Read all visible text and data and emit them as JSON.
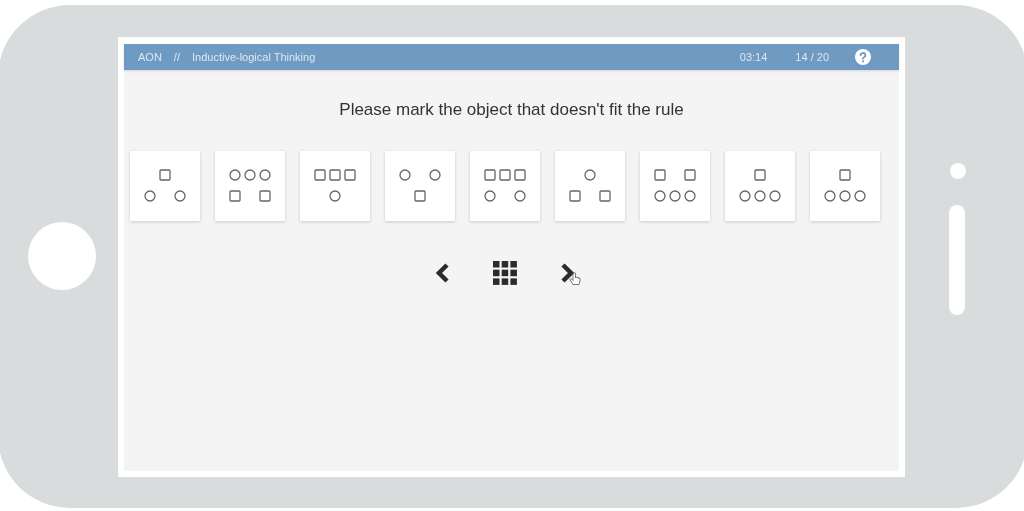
{
  "header": {
    "brand": "AON",
    "separator": "//",
    "section": "Inductive-logical Thinking",
    "timer": "03:14",
    "progress": "14 / 20"
  },
  "question": "Please mark the object that doesn't fit the rule",
  "options": [
    {
      "rows": [
        [
          {
            "kind": "square"
          }
        ],
        [
          {
            "kind": "circle"
          },
          {
            "kind": "gap"
          },
          {
            "kind": "circle"
          }
        ]
      ]
    },
    {
      "rows": [
        [
          {
            "kind": "circle"
          },
          {
            "kind": "circle"
          },
          {
            "kind": "circle"
          }
        ],
        [
          {
            "kind": "square"
          },
          {
            "kind": "gap"
          },
          {
            "kind": "square"
          }
        ]
      ]
    },
    {
      "rows": [
        [
          {
            "kind": "square"
          },
          {
            "kind": "square"
          },
          {
            "kind": "square"
          }
        ],
        [
          {
            "kind": "circle"
          }
        ]
      ]
    },
    {
      "rows": [
        [
          {
            "kind": "circle"
          },
          {
            "kind": "gap"
          },
          {
            "kind": "circle"
          }
        ],
        [
          {
            "kind": "square"
          }
        ]
      ]
    },
    {
      "rows": [
        [
          {
            "kind": "square"
          },
          {
            "kind": "square"
          },
          {
            "kind": "square"
          }
        ],
        [
          {
            "kind": "circle"
          },
          {
            "kind": "gap"
          },
          {
            "kind": "circle"
          }
        ]
      ]
    },
    {
      "rows": [
        [
          {
            "kind": "circle"
          }
        ],
        [
          {
            "kind": "square"
          },
          {
            "kind": "gap"
          },
          {
            "kind": "square"
          }
        ]
      ]
    },
    {
      "rows": [
        [
          {
            "kind": "square"
          },
          {
            "kind": "gap"
          },
          {
            "kind": "square"
          }
        ],
        [
          {
            "kind": "circle"
          },
          {
            "kind": "circle"
          },
          {
            "kind": "circle"
          }
        ]
      ]
    },
    {
      "rows": [
        [
          {
            "kind": "square"
          }
        ],
        [
          {
            "kind": "circle"
          },
          {
            "kind": "circle"
          },
          {
            "kind": "circle"
          }
        ]
      ]
    },
    {
      "rows": [
        [
          {
            "kind": "square"
          }
        ],
        [
          {
            "kind": "circle"
          },
          {
            "kind": "circle"
          },
          {
            "kind": "circle"
          }
        ]
      ]
    }
  ]
}
